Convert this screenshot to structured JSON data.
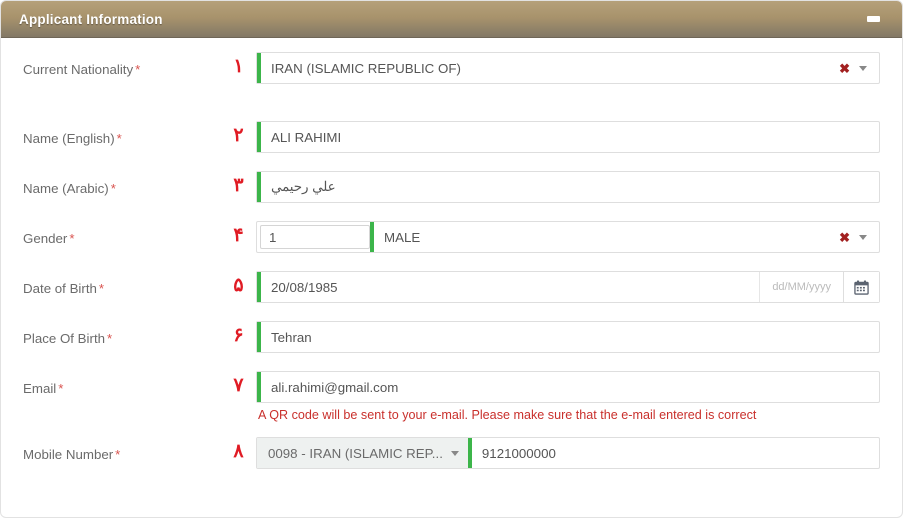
{
  "header": {
    "title": "Applicant Information",
    "minimize_label": "minimize"
  },
  "form": {
    "rows": [
      {
        "label": "Current Nationality",
        "required_mark": "*",
        "step": "١",
        "type": "select",
        "value": "IRAN (ISLAMIC REPUBLIC OF)",
        "valid": true,
        "clear_label": "✖"
      },
      {
        "label": "Name (English)",
        "required_mark": "*",
        "step": "٢",
        "type": "text",
        "value": "ALI RAHIMI",
        "valid": true
      },
      {
        "label": "Name (Arabic)",
        "required_mark": "*",
        "step": "٣",
        "type": "text-rtl",
        "value": "علي رحيمي",
        "valid": true
      },
      {
        "label": "Gender",
        "required_mark": "*",
        "step": "۴",
        "type": "select-with-code",
        "code_value": "1",
        "value": "MALE",
        "valid": true,
        "clear_label": "✖"
      },
      {
        "label": "Date of Birth",
        "required_mark": "*",
        "step": "۵",
        "type": "date",
        "value": "20/08/1985",
        "format_hint": "dd/MM/yyyy",
        "valid": true
      },
      {
        "label": "Place Of Birth",
        "required_mark": "*",
        "step": "۶",
        "type": "text",
        "value": "Tehran",
        "valid": true
      },
      {
        "label": "Email",
        "required_mark": "*",
        "step": "٧",
        "type": "text",
        "value": "ali.rahimi@gmail.com",
        "valid": true,
        "hint": "A QR code will be sent to your e-mail. Please make sure that the e-mail entered is correct"
      },
      {
        "label": "Mobile Number",
        "required_mark": "*",
        "step": "٨",
        "type": "phone",
        "country_code": "0098 - IRAN (ISLAMIC REP...",
        "value": "9121000000",
        "valid": true
      }
    ]
  },
  "colors": {
    "header_top": "#b5a07a",
    "header_bottom": "#827866",
    "valid_green": "#3cb54a",
    "required_red": "#d9534f",
    "step_red": "#e01b24",
    "hint_red": "#c9302c"
  }
}
